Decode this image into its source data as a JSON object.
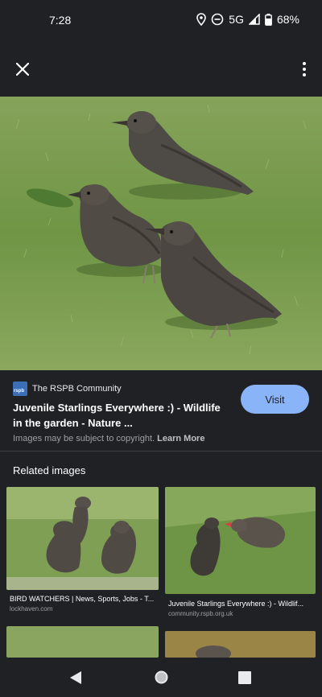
{
  "status_bar": {
    "time": "7:28",
    "network": "5G",
    "battery": "68%"
  },
  "toolbar": {
    "close_icon": "close-icon",
    "more_icon": "more-vert-icon"
  },
  "result": {
    "source_name": "The RSPB Community",
    "favicon_text": "rspb",
    "title": "Juvenile Starlings Everywhere :) - Wildlife in the garden - Nature ...",
    "visit_label": "Visit",
    "copyright_text": "Images may be subject to copyright.",
    "learn_more_label": "Learn More"
  },
  "related": {
    "heading": "Related images",
    "items": [
      {
        "caption": "BIRD WATCHERS | News, Sports, Jobs - T...",
        "domain": "lockhaven.com"
      },
      {
        "caption": "Juvenile Starlings Everywhere :) - Wildlif...",
        "domain": "community.rspb.org.uk"
      }
    ]
  },
  "colors": {
    "background": "#202124",
    "accent": "#8ab4f8"
  }
}
